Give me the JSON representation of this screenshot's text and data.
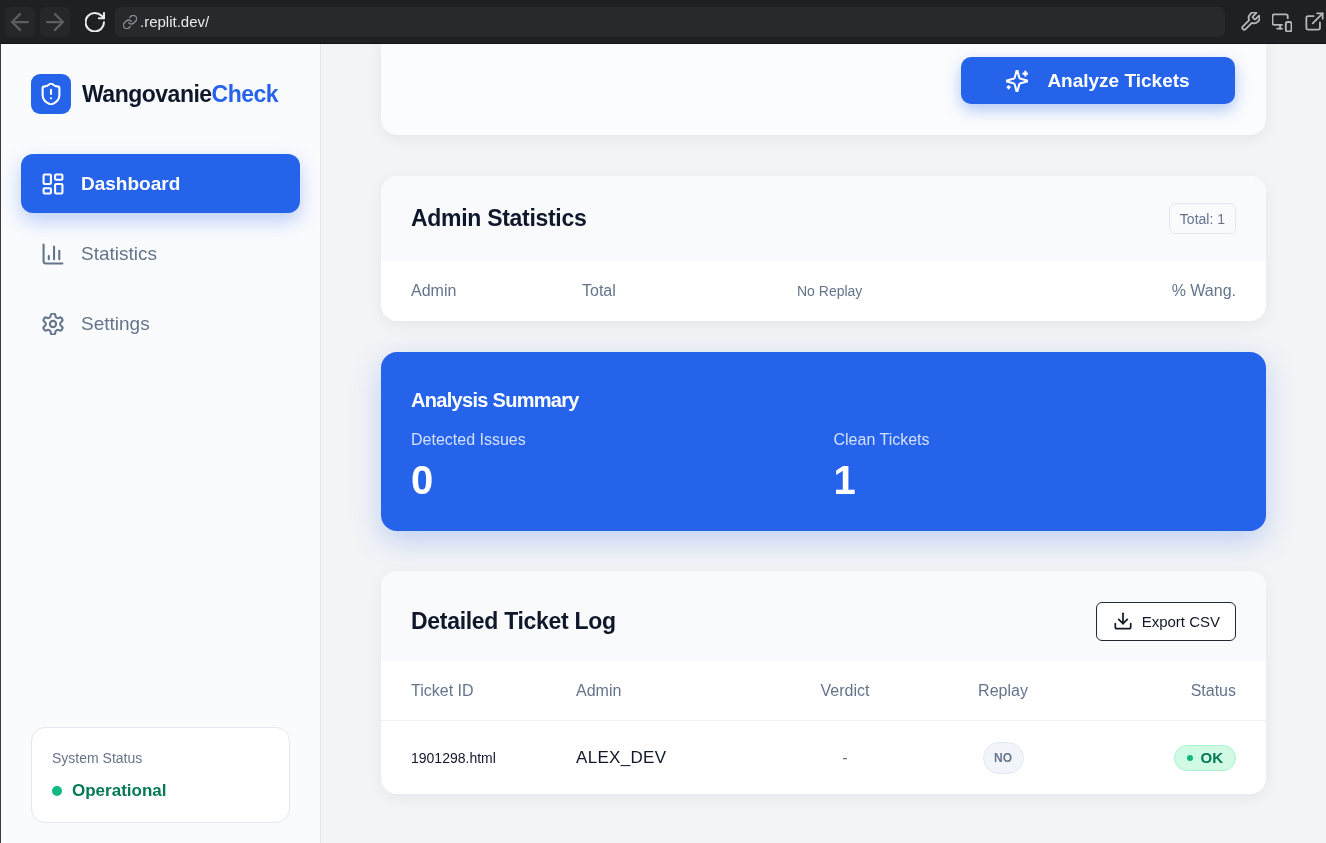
{
  "browser": {
    "back": {
      "disabled": true
    },
    "forward": {
      "disabled": true
    },
    "url": ".replit.dev/"
  },
  "sidebar": {
    "brand": {
      "name": "Wangovanie",
      "accent": "Check"
    },
    "nav": [
      {
        "label": "Dashboard",
        "selected": true
      },
      {
        "label": "Statistics",
        "selected": false
      },
      {
        "label": "Settings",
        "selected": false
      }
    ],
    "system_status": {
      "label": "System Status",
      "value": "Operational",
      "kind": "success"
    }
  },
  "toolbar": {
    "analyze_button": "Analyze Tickets"
  },
  "admin_statistics": {
    "title": "Admin Statistics",
    "total_badge": "Total: 1",
    "columns": [
      "Admin",
      "Total",
      "No Replay",
      "% Wang."
    ]
  },
  "analysis_summary": {
    "title": "Analysis Summary",
    "metrics": [
      {
        "label": "Detected Issues",
        "value": "0"
      },
      {
        "label": "Clean Tickets",
        "value": "1"
      }
    ]
  },
  "ticket_log": {
    "title": "Detailed Ticket Log",
    "export_button": "Export CSV",
    "columns": [
      "Ticket ID",
      "Admin",
      "Verdict",
      "Replay",
      "Status"
    ],
    "rows": [
      {
        "ticket_id": "1901298.html",
        "admin": "ALEX_DEV",
        "verdict": "-",
        "replay": {
          "text": "NO",
          "kind": "neutral"
        },
        "status": {
          "text": "OK",
          "kind": "success"
        }
      }
    ]
  }
}
